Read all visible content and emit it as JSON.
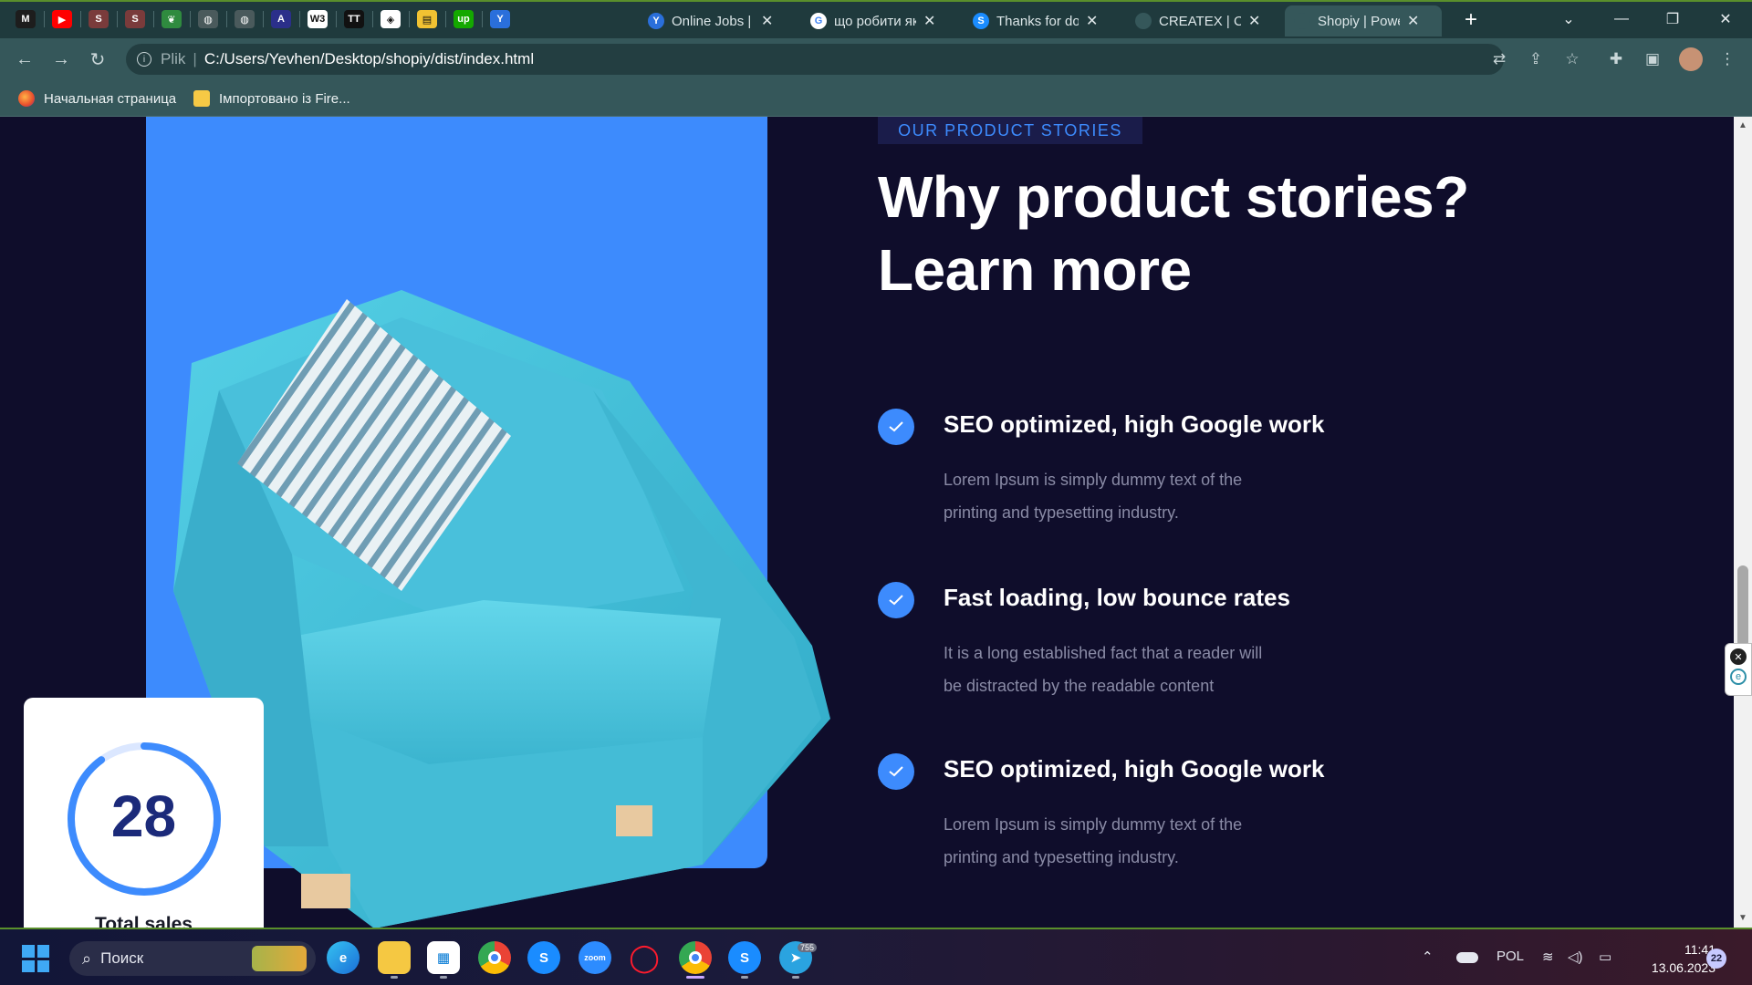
{
  "browser": {
    "pinned_tabs": [
      {
        "name": "m-tab",
        "glyph": "M"
      },
      {
        "name": "youtube-tab",
        "glyph": "▶"
      },
      {
        "name": "app-tab-1",
        "glyph": "S"
      },
      {
        "name": "app-tab-2",
        "glyph": "S"
      },
      {
        "name": "leaf-tab",
        "glyph": "❦"
      },
      {
        "name": "globe-tab-1",
        "glyph": "◍"
      },
      {
        "name": "globe-tab-2",
        "glyph": "◍"
      },
      {
        "name": "a-tab",
        "glyph": "A"
      },
      {
        "name": "w3-tab",
        "glyph": "W3"
      },
      {
        "name": "tt-tab",
        "glyph": "TT"
      },
      {
        "name": "codepen-tab",
        "glyph": "◈"
      },
      {
        "name": "book-tab",
        "glyph": "▤"
      },
      {
        "name": "upwork-tab",
        "glyph": "up"
      },
      {
        "name": "freelance-tab",
        "glyph": "Y"
      }
    ],
    "tabs": [
      {
        "title": "Online Jobs | Fr",
        "fav": "Y",
        "fav_color": "#2a6fdb",
        "active": false
      },
      {
        "title": "що робити які",
        "fav": "G",
        "fav_color": "#ffffff",
        "active": false
      },
      {
        "title": "Thanks for dow",
        "fav": "S",
        "fav_color": "#1a8cff",
        "active": false
      },
      {
        "title": "CREATEX | Cou",
        "fav": "",
        "fav_color": "#35575a",
        "active": false
      },
      {
        "title": "Shopiy | Power",
        "fav": "",
        "fav_color": "#35575a",
        "active": true
      }
    ],
    "new_tab": "+",
    "url_scheme": "Plik",
    "url": "C:/Users/Yevhen/Desktop/shopiy/dist/index.html",
    "bookmarks": [
      {
        "label": "Начальная страница"
      },
      {
        "label": "Імпортовано із Fire..."
      }
    ]
  },
  "page": {
    "eyebrow": "OUR PRODUCT STORIES",
    "heading_line1": "Why product stories?",
    "heading_line2": "Learn more",
    "features": [
      {
        "title": "SEO optimized, high Google work",
        "desc_line1": "Lorem Ipsum is simply dummy text of the",
        "desc_line2": "printing and typesetting industry."
      },
      {
        "title": "Fast loading, low bounce rates",
        "desc_line1": "It is a long established fact that a reader will",
        "desc_line2": "be distracted by the readable content"
      },
      {
        "title": "SEO optimized, high Google work",
        "desc_line1": "Lorem Ipsum is simply dummy text of the",
        "desc_line2": "printing and typesetting industry."
      }
    ],
    "stats": {
      "value": "28",
      "label": "Total sales",
      "progress": 0.9
    },
    "colors": {
      "accent": "#3d8bfd",
      "background": "#0f0d2b",
      "chair": "#45c3dd"
    }
  },
  "taskbar": {
    "search_placeholder": "Поиск",
    "language": "POL",
    "time": "11:41",
    "date": "13.06.2023",
    "notification_count": "22",
    "telegram_badge": "755",
    "zoom_label": "zoom"
  }
}
